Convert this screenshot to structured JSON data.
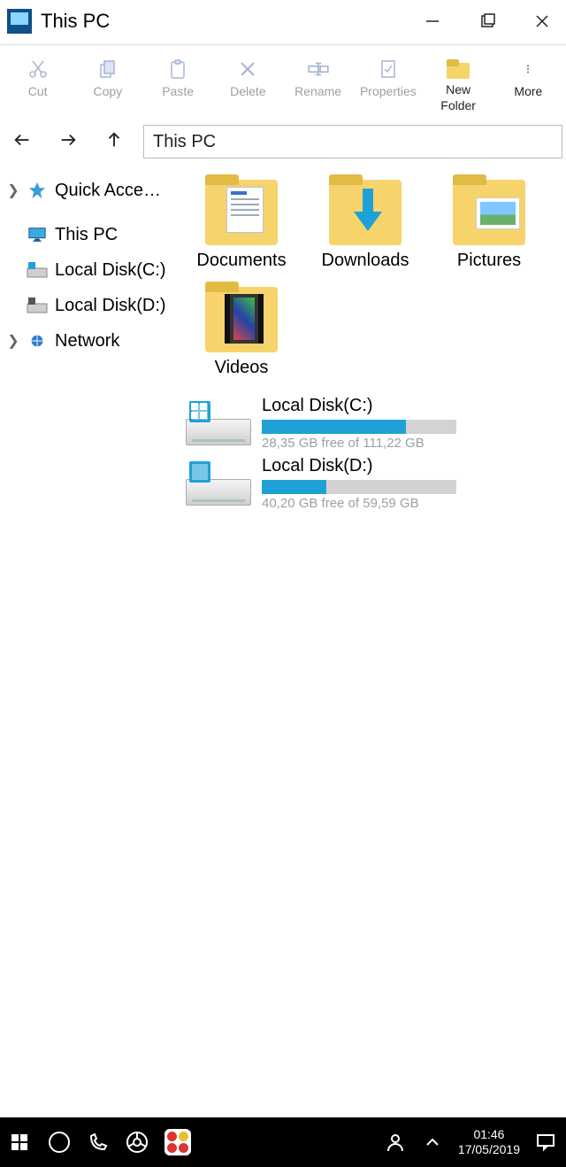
{
  "window": {
    "title": "This PC"
  },
  "toolbar": {
    "cut": "Cut",
    "copy": "Copy",
    "paste": "Paste",
    "delete": "Delete",
    "rename": "Rename",
    "properties": "Properties",
    "new_folder_label1": "New",
    "new_folder_label2": "Folder",
    "more": "More"
  },
  "address": {
    "path": "This PC"
  },
  "sidebar": {
    "items": [
      {
        "label": "Quick Acce…",
        "icon": "star-icon",
        "expandable": true
      },
      {
        "label": "This PC",
        "icon": "monitor-icon",
        "expandable": false
      },
      {
        "label": "Local Disk(C:)",
        "icon": "disk-icon",
        "expandable": false
      },
      {
        "label": "Local Disk(D:)",
        "icon": "disk-icon",
        "expandable": false
      },
      {
        "label": "Network",
        "icon": "network-icon",
        "expandable": true
      }
    ]
  },
  "folders": [
    {
      "label": "Documents"
    },
    {
      "label": "Downloads"
    },
    {
      "label": "Pictures"
    },
    {
      "label": "Videos"
    }
  ],
  "drives": [
    {
      "name": "Local Disk(C:)",
      "free_text": "28,35 GB free of 111,22 GB",
      "used_pct": 74
    },
    {
      "name": "Local Disk(D:)",
      "free_text": "40,20 GB free of 59,59 GB",
      "used_pct": 33
    }
  ],
  "taskbar": {
    "time": "01:46",
    "date": "17/05/2019"
  }
}
